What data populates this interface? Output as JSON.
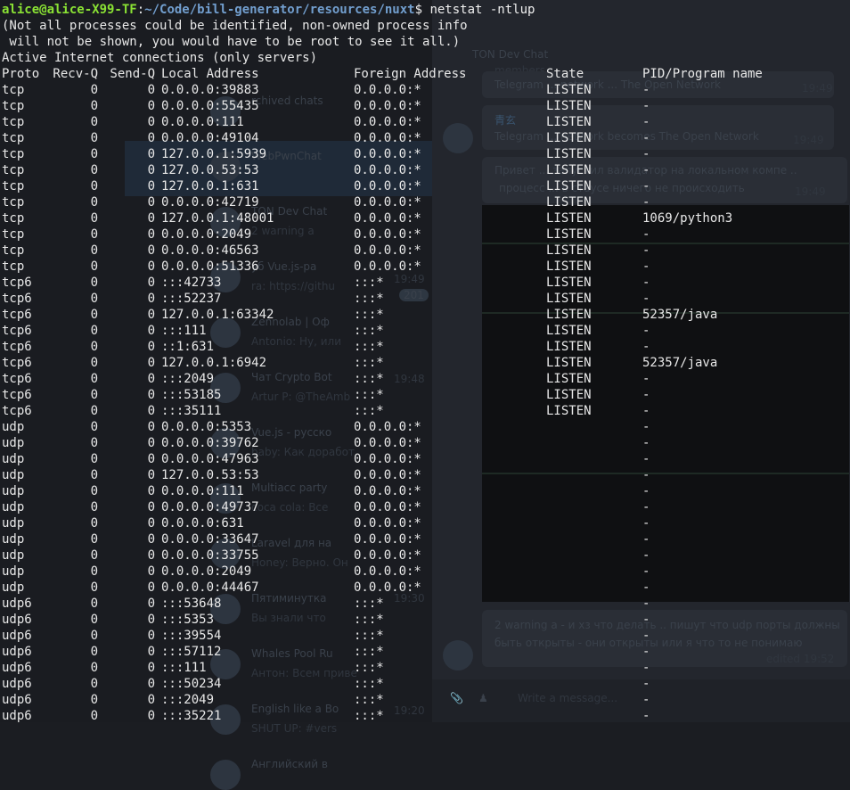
{
  "prompt": {
    "user_host": "alice@alice-X99-TF",
    "separator": ":",
    "path": "~/Code/bill-generator/resources/nuxt",
    "dollar": "$ ",
    "command": "netstat -ntlup"
  },
  "messages": [
    "(Not all processes could be identified, non-owned process info",
    " will not be shown, you would have to be root to see it all.)",
    "Active Internet connections (only servers)"
  ],
  "headers": {
    "proto": "Proto",
    "recv": "Recv-Q",
    "send": "Send-Q",
    "local": "Local Address",
    "foreign": "Foreign Address",
    "state": "State",
    "pid": "PID/Program name"
  },
  "rows": [
    {
      "proto": "tcp",
      "recv": "0",
      "send": "0",
      "local": "0.0.0.0:39883",
      "foreign": "0.0.0.0:*",
      "state": "LISTEN",
      "pid": "-"
    },
    {
      "proto": "tcp",
      "recv": "0",
      "send": "0",
      "local": "0.0.0.0:55435",
      "foreign": "0.0.0.0:*",
      "state": "LISTEN",
      "pid": "-"
    },
    {
      "proto": "tcp",
      "recv": "0",
      "send": "0",
      "local": "0.0.0.0:111",
      "foreign": "0.0.0.0:*",
      "state": "LISTEN",
      "pid": "-"
    },
    {
      "proto": "tcp",
      "recv": "0",
      "send": "0",
      "local": "0.0.0.0:49104",
      "foreign": "0.0.0.0:*",
      "state": "LISTEN",
      "pid": "-"
    },
    {
      "proto": "tcp",
      "recv": "0",
      "send": "0",
      "local": "127.0.0.1:5939",
      "foreign": "0.0.0.0:*",
      "state": "LISTEN",
      "pid": "-"
    },
    {
      "proto": "tcp",
      "recv": "0",
      "send": "0",
      "local": "127.0.0.53:53",
      "foreign": "0.0.0.0:*",
      "state": "LISTEN",
      "pid": "-"
    },
    {
      "proto": "tcp",
      "recv": "0",
      "send": "0",
      "local": "127.0.0.1:631",
      "foreign": "0.0.0.0:*",
      "state": "LISTEN",
      "pid": "-"
    },
    {
      "proto": "tcp",
      "recv": "0",
      "send": "0",
      "local": "0.0.0.0:42719",
      "foreign": "0.0.0.0:*",
      "state": "LISTEN",
      "pid": "-"
    },
    {
      "proto": "tcp",
      "recv": "0",
      "send": "0",
      "local": "127.0.0.1:48001",
      "foreign": "0.0.0.0:*",
      "state": "LISTEN",
      "pid": "1069/python3"
    },
    {
      "proto": "tcp",
      "recv": "0",
      "send": "0",
      "local": "0.0.0.0:2049",
      "foreign": "0.0.0.0:*",
      "state": "LISTEN",
      "pid": "-"
    },
    {
      "proto": "tcp",
      "recv": "0",
      "send": "0",
      "local": "0.0.0.0:46563",
      "foreign": "0.0.0.0:*",
      "state": "LISTEN",
      "pid": "-"
    },
    {
      "proto": "tcp",
      "recv": "0",
      "send": "0",
      "local": "0.0.0.0:51336",
      "foreign": "0.0.0.0:*",
      "state": "LISTEN",
      "pid": "-"
    },
    {
      "proto": "tcp6",
      "recv": "0",
      "send": "0",
      "local": ":::42733",
      "foreign": ":::*",
      "state": "LISTEN",
      "pid": "-"
    },
    {
      "proto": "tcp6",
      "recv": "0",
      "send": "0",
      "local": ":::52237",
      "foreign": ":::*",
      "state": "LISTEN",
      "pid": "-"
    },
    {
      "proto": "tcp6",
      "recv": "0",
      "send": "0",
      "local": "127.0.0.1:63342",
      "foreign": ":::*",
      "state": "LISTEN",
      "pid": "52357/java"
    },
    {
      "proto": "tcp6",
      "recv": "0",
      "send": "0",
      "local": ":::111",
      "foreign": ":::*",
      "state": "LISTEN",
      "pid": "-"
    },
    {
      "proto": "tcp6",
      "recv": "0",
      "send": "0",
      "local": "::1:631",
      "foreign": ":::*",
      "state": "LISTEN",
      "pid": "-"
    },
    {
      "proto": "tcp6",
      "recv": "0",
      "send": "0",
      "local": "127.0.0.1:6942",
      "foreign": ":::*",
      "state": "LISTEN",
      "pid": "52357/java"
    },
    {
      "proto": "tcp6",
      "recv": "0",
      "send": "0",
      "local": ":::2049",
      "foreign": ":::*",
      "state": "LISTEN",
      "pid": "-"
    },
    {
      "proto": "tcp6",
      "recv": "0",
      "send": "0",
      "local": ":::53185",
      "foreign": ":::*",
      "state": "LISTEN",
      "pid": "-"
    },
    {
      "proto": "tcp6",
      "recv": "0",
      "send": "0",
      "local": ":::35111",
      "foreign": ":::*",
      "state": "LISTEN",
      "pid": "-"
    },
    {
      "proto": "udp",
      "recv": "0",
      "send": "0",
      "local": "0.0.0.0:5353",
      "foreign": "0.0.0.0:*",
      "state": "",
      "pid": "-"
    },
    {
      "proto": "udp",
      "recv": "0",
      "send": "0",
      "local": "0.0.0.0:39762",
      "foreign": "0.0.0.0:*",
      "state": "",
      "pid": "-"
    },
    {
      "proto": "udp",
      "recv": "0",
      "send": "0",
      "local": "0.0.0.0:47963",
      "foreign": "0.0.0.0:*",
      "state": "",
      "pid": "-"
    },
    {
      "proto": "udp",
      "recv": "0",
      "send": "0",
      "local": "127.0.0.53:53",
      "foreign": "0.0.0.0:*",
      "state": "",
      "pid": "-"
    },
    {
      "proto": "udp",
      "recv": "0",
      "send": "0",
      "local": "0.0.0.0:111",
      "foreign": "0.0.0.0:*",
      "state": "",
      "pid": "-"
    },
    {
      "proto": "udp",
      "recv": "0",
      "send": "0",
      "local": "0.0.0.0:49737",
      "foreign": "0.0.0.0:*",
      "state": "",
      "pid": "-"
    },
    {
      "proto": "udp",
      "recv": "0",
      "send": "0",
      "local": "0.0.0.0:631",
      "foreign": "0.0.0.0:*",
      "state": "",
      "pid": "-"
    },
    {
      "proto": "udp",
      "recv": "0",
      "send": "0",
      "local": "0.0.0.0:33647",
      "foreign": "0.0.0.0:*",
      "state": "",
      "pid": "-"
    },
    {
      "proto": "udp",
      "recv": "0",
      "send": "0",
      "local": "0.0.0.0:33755",
      "foreign": "0.0.0.0:*",
      "state": "",
      "pid": "-"
    },
    {
      "proto": "udp",
      "recv": "0",
      "send": "0",
      "local": "0.0.0.0:2049",
      "foreign": "0.0.0.0:*",
      "state": "",
      "pid": "-"
    },
    {
      "proto": "udp",
      "recv": "0",
      "send": "0",
      "local": "0.0.0.0:44467",
      "foreign": "0.0.0.0:*",
      "state": "",
      "pid": "-"
    },
    {
      "proto": "udp6",
      "recv": "0",
      "send": "0",
      "local": ":::53648",
      "foreign": ":::*",
      "state": "",
      "pid": "-"
    },
    {
      "proto": "udp6",
      "recv": "0",
      "send": "0",
      "local": ":::5353",
      "foreign": ":::*",
      "state": "",
      "pid": "-"
    },
    {
      "proto": "udp6",
      "recv": "0",
      "send": "0",
      "local": ":::39554",
      "foreign": ":::*",
      "state": "",
      "pid": "-"
    },
    {
      "proto": "udp6",
      "recv": "0",
      "send": "0",
      "local": ":::57112",
      "foreign": ":::*",
      "state": "",
      "pid": "-"
    },
    {
      "proto": "udp6",
      "recv": "0",
      "send": "0",
      "local": ":::111",
      "foreign": ":::*",
      "state": "",
      "pid": "-"
    },
    {
      "proto": "udp6",
      "recv": "0",
      "send": "0",
      "local": ":::50234",
      "foreign": ":::*",
      "state": "",
      "pid": "-"
    },
    {
      "proto": "udp6",
      "recv": "0",
      "send": "0",
      "local": ":::2049",
      "foreign": ":::*",
      "state": "",
      "pid": "-"
    },
    {
      "proto": "udp6",
      "recv": "0",
      "send": "0",
      "local": ":::35221",
      "foreign": ":::*",
      "state": "",
      "pid": "-"
    }
  ],
  "background": {
    "chat_list": [
      {
        "name": "rchived chats",
        "preview": ""
      },
      {
        "name": "WebPwnChat",
        "preview": ""
      },
      {
        "name": "TON Dev Chat",
        "preview": "2 warning a"
      },
      {
        "name": "уб Vue.js-ра",
        "preview": "ra: https://githu"
      },
      {
        "name": "Zennolab | Оф",
        "preview": "Antonio: Ну, или"
      },
      {
        "name": "Чат Crypto Bot",
        "preview": "Artur P: @TheAmb"
      },
      {
        "name": "Vue.js - русско",
        "preview": "baby: Как доработ"
      },
      {
        "name": "Multiacc party",
        "preview": "coca cola: Все"
      },
      {
        "name": "Laravel для на",
        "preview": "Honey: Верно. Он"
      },
      {
        "name": "Пятиминутка",
        "preview": "Вы знали что"
      },
      {
        "name": "Whales Pool Ru",
        "preview": "Антон: Всем приве"
      },
      {
        "name": "English like a Bo",
        "preview": "SHUT UP: #vers"
      },
      {
        "name": "Английский в",
        "preview": ""
      }
    ],
    "list_meta": [
      {
        "time": "19:49",
        "badge": "201"
      },
      {
        "time": "19:48",
        "badge": ""
      },
      {
        "time": "19:30",
        "badge": ""
      },
      {
        "time": "19:20",
        "badge": ""
      }
    ],
    "chat_header": {
      "title": "TON Dev Chat",
      "subtitle": "members"
    },
    "messages": [
      {
        "sender": "",
        "text": "Telegram ... network ... The Open Network",
        "time": "19:49"
      },
      {
        "sender": "青玄",
        "text": "Telegram ... network becomes The Open Network",
        "time": "19:49"
      },
      {
        "sender": "",
        "text": "Привет ... запустил валидатор на локальном компе ..",
        "time": ""
      },
      {
        "sender": "",
        "text": "процесс ... в стаусе ничего не происходить",
        "time": "19:49"
      },
      {
        "sender": "",
        "text": "2 warning a - и хз что делать .. пишут что udp порты должны",
        "time": ""
      },
      {
        "sender": "",
        "text": "быть открыты - они открыты или я что то не понимаю",
        "time": "edited 19:52"
      }
    ],
    "input_placeholder": "Write a message..."
  }
}
